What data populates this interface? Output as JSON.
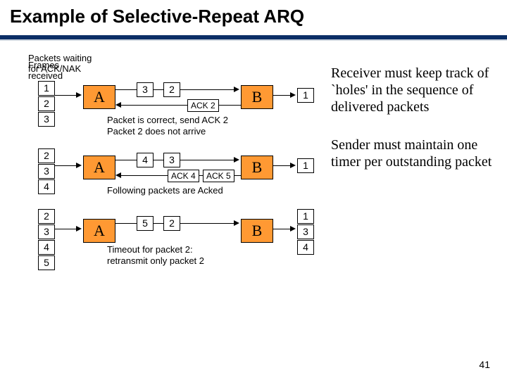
{
  "title": "Example of Selective-Repeat ARQ",
  "page_number": "41",
  "notes": {
    "receiver": "Receiver must keep track of `holes' in the sequence of delivered packets",
    "sender": "Sender must maintain one timer per outstanding packet"
  },
  "diagram": {
    "packets_waiting_label": "Packets waiting\nfor ACK/NAK",
    "frames_received_label": "Frames\nreceived",
    "row1": {
      "queueA": [
        "1",
        "2",
        "3"
      ],
      "nodeA": "A",
      "in_transit": [
        "3",
        "2"
      ],
      "nodeB": "B",
      "queueB": [
        "1"
      ],
      "ack": "ACK 2",
      "caption1": "Packet is correct, send ACK 2",
      "caption2": "Packet 2 does not arrive"
    },
    "row2": {
      "queueA": [
        "2",
        "3",
        "4"
      ],
      "nodeA": "A",
      "in_transit": [
        "4",
        "3"
      ],
      "nodeB": "B",
      "queueB": [
        "1"
      ],
      "acks": [
        "ACK 4",
        "ACK 5"
      ],
      "caption": "Following packets are Acked"
    },
    "row3": {
      "queueA": [
        "2",
        "3",
        "4",
        "5"
      ],
      "nodeA": "A",
      "in_transit": [
        "5",
        "2"
      ],
      "nodeB": "B",
      "queueB": [
        "1",
        "3",
        "4"
      ],
      "caption1": "Timeout for packet 2:",
      "caption2": "retransmit only packet 2"
    }
  }
}
